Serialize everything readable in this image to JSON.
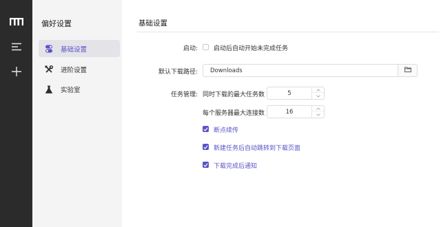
{
  "rail": {
    "icons": [
      "app-logo-icon",
      "menu-icon",
      "add-icon"
    ]
  },
  "sidebar": {
    "title": "偏好设置",
    "items": [
      {
        "label": "基础设置",
        "icon": "toggle-icon",
        "active": true
      },
      {
        "label": "进阶设置",
        "icon": "tools-icon",
        "active": false
      },
      {
        "label": "实验室",
        "icon": "flask-icon",
        "active": false
      }
    ]
  },
  "main": {
    "title": "基础设置",
    "startup": {
      "label": "启动:",
      "option_label": "启动后自动开始未完成任务",
      "checked": false
    },
    "download_path": {
      "label": "默认下载路径:",
      "value": "Downloads",
      "browse_icon": "folder-icon"
    },
    "task_management": {
      "label": "任务管理:",
      "max_tasks_label": "同时下载的最大任务数",
      "max_tasks_value": "5",
      "max_connections_label": "每个服务器最大连接数",
      "max_connections_value": "16",
      "options": [
        {
          "label": "断点续传",
          "checked": true
        },
        {
          "label": "新建任务后自动跳转到下载页面",
          "checked": true
        },
        {
          "label": "下载完成后通知",
          "checked": true
        }
      ]
    }
  },
  "colors": {
    "accent": "#5b53c7",
    "rail_bg": "#2b2b2b",
    "sidebar_bg": "#f4f4f5"
  }
}
